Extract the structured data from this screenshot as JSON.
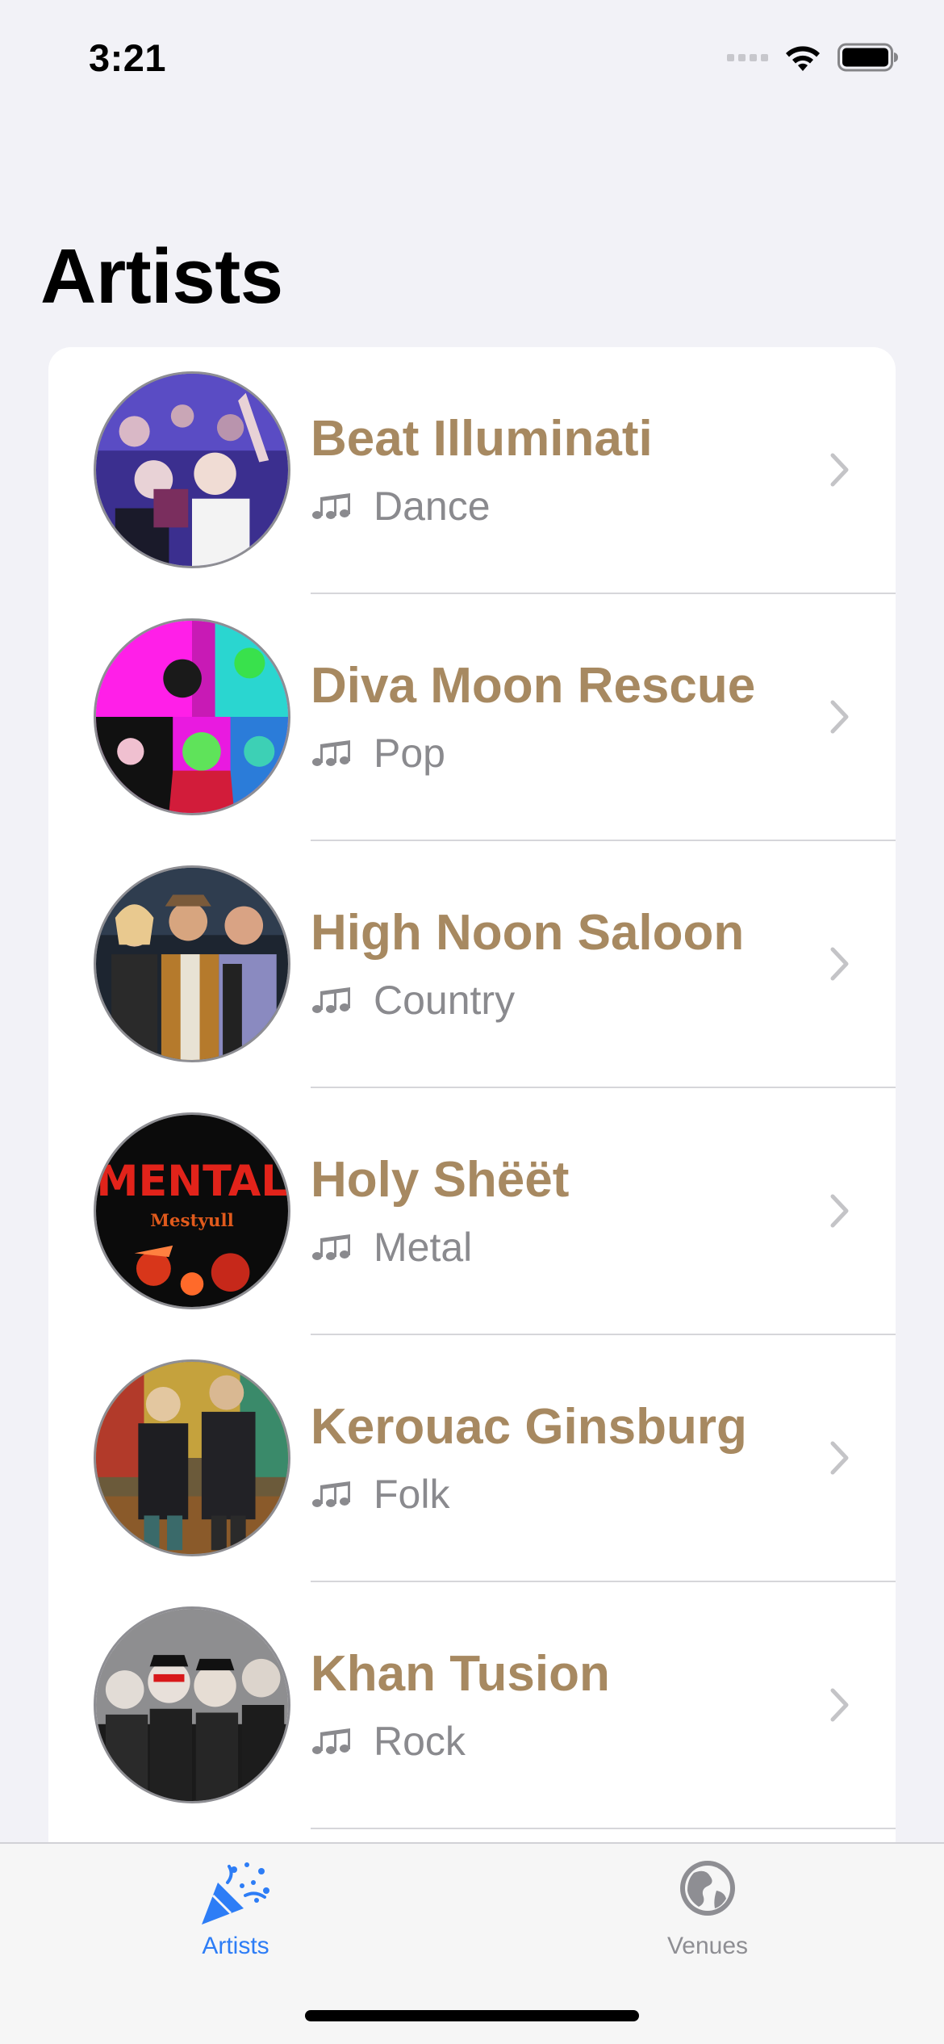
{
  "status_bar": {
    "time": "3:21"
  },
  "page": {
    "title": "Artists"
  },
  "artists": [
    {
      "name": "Beat Illuminati",
      "genre": "Dance",
      "genre_icon": "music-notes-icon"
    },
    {
      "name": "Diva Moon Rescue",
      "genre": "Pop",
      "genre_icon": "music-notes-icon"
    },
    {
      "name": "High Noon Saloon",
      "genre": "Country",
      "genre_icon": "music-notes-icon"
    },
    {
      "name": "Holy Shëët",
      "genre": "Metal",
      "genre_icon": "music-notes-icon",
      "avatar_text": [
        "MENTAL",
        "Mestyull"
      ]
    },
    {
      "name": "Kerouac Ginsburg",
      "genre": "Folk",
      "genre_icon": "music-notes-icon"
    },
    {
      "name": "Khan Tusion",
      "genre": "Rock",
      "genre_icon": "music-notes-icon"
    }
  ],
  "tab_bar": {
    "tabs": [
      {
        "label": "Artists",
        "icon": "party-popper-icon",
        "selected": true
      },
      {
        "label": "Venues",
        "icon": "globe-icon",
        "selected": false
      }
    ]
  },
  "colors": {
    "accent_name": "#a78961",
    "tab_selected": "#2d7df6",
    "tab_unselected": "#8e8e93",
    "secondary_text": "#8a8a8e",
    "background": "#f2f2f7"
  }
}
